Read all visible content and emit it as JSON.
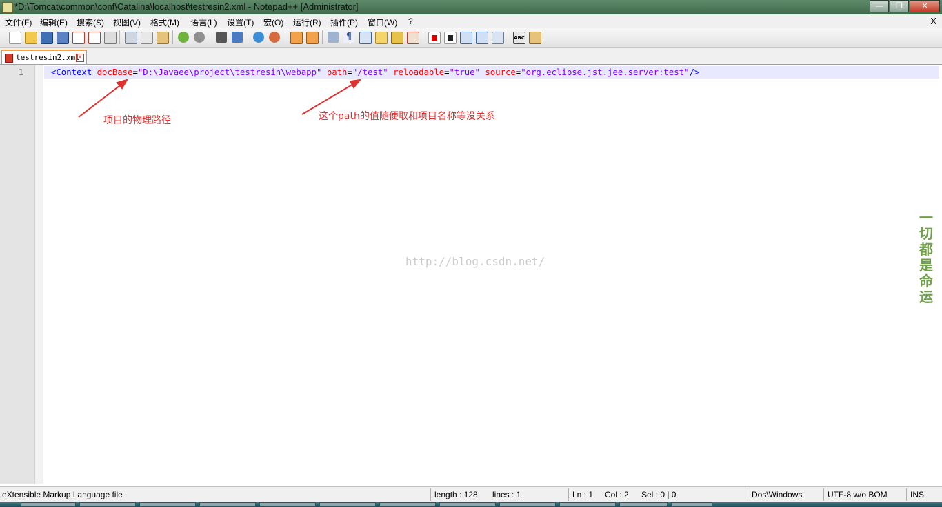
{
  "window": {
    "title": "*D:\\Tomcat\\common\\conf\\Catalina\\localhost\\testresin2.xml - Notepad++ [Administrator]",
    "menu_close": "X"
  },
  "menu": [
    {
      "label": "文件(F)"
    },
    {
      "label": "编辑(E)"
    },
    {
      "label": "搜索(S)"
    },
    {
      "label": "视图(V)"
    },
    {
      "label": "格式(M)"
    },
    {
      "label": "语言(L)"
    },
    {
      "label": "设置(T)"
    },
    {
      "label": "宏(O)"
    },
    {
      "label": "运行(R)"
    },
    {
      "label": "插件(P)"
    },
    {
      "label": "窗口(W)"
    },
    {
      "label": "?"
    }
  ],
  "toolbar_icons": [
    "new-file-icon",
    "open-file-icon",
    "save-icon",
    "save-all-icon",
    "close-icon",
    "close-all-icon",
    "print-icon",
    "cut-icon",
    "copy-icon",
    "paste-icon",
    "undo-icon",
    "redo-icon",
    "find-icon",
    "replace-icon",
    "zoom-in-icon",
    "zoom-out-icon",
    "sync-vertical-icon",
    "sync-horizontal-icon",
    "word-wrap-icon",
    "show-all-chars-icon",
    "indent-guide-icon",
    "user-lang-icon",
    "doc-map-icon",
    "function-list-icon",
    "record-macro-icon",
    "stop-record-icon",
    "play-macro-icon",
    "run-macro-multiple-icon",
    "save-macro-icon",
    "spell-check-icon",
    "plugin-icon"
  ],
  "tab": {
    "label": "testresin2.xml",
    "close": "x"
  },
  "editor": {
    "line_number": "1",
    "code": {
      "open": "<Context",
      "attr1": "docBase",
      "val1": "\"D:\\Javaee\\project\\testresin\\webapp\"",
      "attr2": "path",
      "val2": "\"/test\"",
      "attr3": "reloadable",
      "val3": "\"true\"",
      "attr4": "source",
      "val4": "\"org.eclipse.jst.jee.server:test\"",
      "close": "/>"
    }
  },
  "annotations": {
    "docbase_note": "项目的物理路径",
    "path_note": "这个path的值随便取和项目名称等没关系",
    "color": "#e03030"
  },
  "watermark": "http://blog.csdn.net/",
  "side_text": "一切都是命运",
  "status": {
    "file_type": "eXtensible Markup Language file",
    "length": "length : 128",
    "lines": "lines : 1",
    "ln": "Ln : 1",
    "col": "Col : 2",
    "sel": "Sel : 0 | 0",
    "eol": "Dos\\Windows",
    "encoding": "UTF-8 w/o BOM",
    "mode": "INS"
  }
}
